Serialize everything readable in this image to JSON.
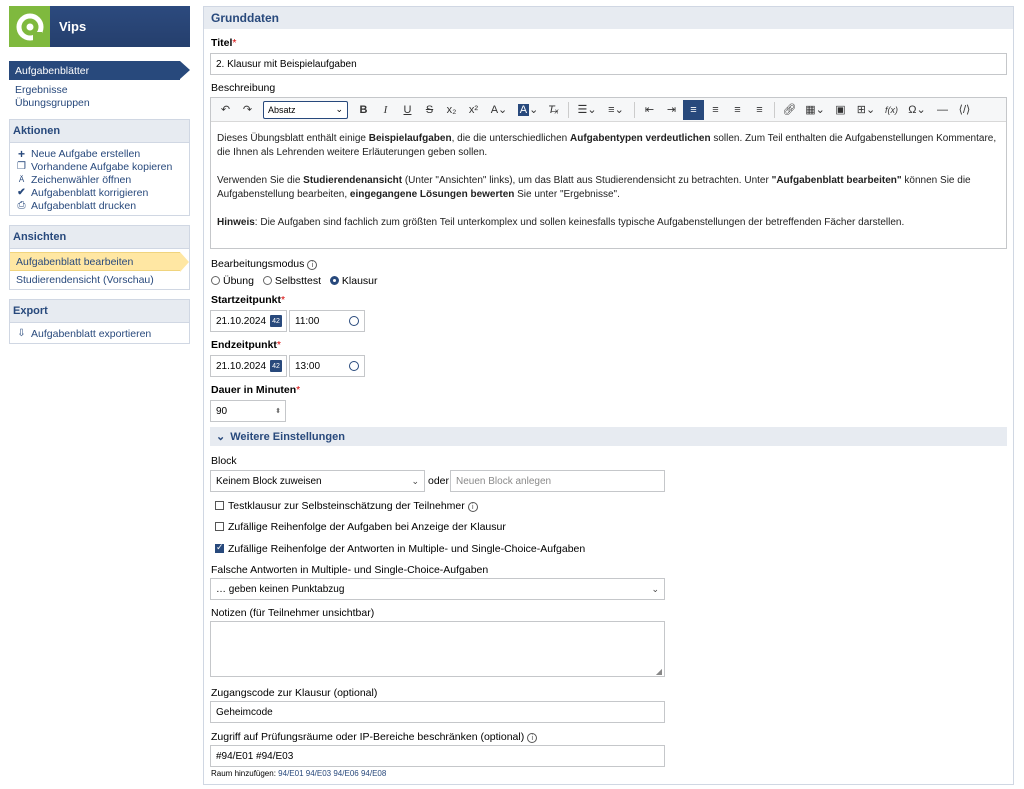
{
  "app": {
    "title": "Vips"
  },
  "nav": {
    "items": [
      "Aufgabenblätter",
      "Ergebnisse",
      "Übungsgruppen"
    ]
  },
  "actions": {
    "heading": "Aktionen",
    "items": [
      {
        "label": "Neue Aufgabe erstellen",
        "icon": "plus-icon"
      },
      {
        "label": "Vorhandene Aufgabe kopieren",
        "icon": "copy-icon"
      },
      {
        "label": "Zeichenwähler öffnen",
        "icon": "char-picker-icon"
      },
      {
        "label": "Aufgabenblatt korrigieren",
        "icon": "check-icon"
      },
      {
        "label": "Aufgabenblatt drucken",
        "icon": "print-icon"
      }
    ]
  },
  "views": {
    "heading": "Ansichten",
    "items": [
      "Aufgabenblatt bearbeiten",
      "Studierendensicht (Vorschau)"
    ]
  },
  "export": {
    "heading": "Export",
    "items": [
      {
        "label": "Aufgabenblatt exportieren",
        "icon": "export-icon"
      }
    ]
  },
  "main": {
    "section_title": "Grunddaten",
    "title_label": "Titel",
    "title_value": "2. Klausur mit Beispielaufgaben",
    "description_label": "Beschreibung",
    "toolbar": {
      "format_select": "Absatz"
    },
    "description": {
      "p1_a": "Dieses Übungsblatt enthält einige ",
      "p1_b": "Beispielaufgaben",
      "p1_c": ", die die unterschiedlichen ",
      "p1_d": "Aufgabentypen verdeutlichen",
      "p1_e": " sollen. Zum Teil enthalten die Aufgabenstellungen Kommentare, die Ihnen als Lehrenden weitere Erläuterungen geben sollen.",
      "p2_a": "Verwenden Sie die ",
      "p2_b": "Studierendenansicht",
      "p2_c": " (Unter \"Ansichten\" links), um das Blatt aus Studierendensicht zu betrachten. Unter ",
      "p2_d": "\"Aufgabenblatt bearbeiten\"",
      "p2_e": " können Sie die Aufgabenstellung bearbeiten, ",
      "p2_f": "eingegangene Lösungen bewerten",
      "p2_g": " Sie unter \"Ergebnisse\".",
      "p3_a": "Hinweis",
      "p3_b": ": Die Aufgaben sind fachlich zum größten Teil unterkomplex und sollen keinesfalls typische Aufgabenstellungen der betreffenden Fächer darstellen."
    },
    "mode_label": "Bearbeitungsmodus",
    "modes": [
      "Übung",
      "Selbsttest",
      "Klausur"
    ],
    "selected_mode": "Klausur",
    "start_label": "Startzeitpunkt",
    "start_date": "21.10.2024",
    "start_time": "11:00",
    "end_label": "Endzeitpunkt",
    "end_date": "21.10.2024",
    "end_time": "13:00",
    "duration_label": "Dauer in Minuten",
    "duration_value": "90",
    "more_settings": "Weitere Einstellungen",
    "block_label": "Block",
    "block_select": "Keinem Block zuweisen",
    "or_text": "oder",
    "new_block_placeholder": "Neuen Block anlegen",
    "options": [
      {
        "label": "Testklausur zur Selbsteinschätzung der Teilnehmer",
        "checked": false,
        "info": true
      },
      {
        "label": "Zufällige Reihenfolge der Aufgaben bei Anzeige der Klausur",
        "checked": false,
        "info": false
      },
      {
        "label": "Zufällige Reihenfolge der Antworten in Multiple- und Single-Choice-Aufgaben",
        "checked": true,
        "info": false
      }
    ],
    "wrong_answers_label": "Falsche Antworten in Multiple- und Single-Choice-Aufgaben",
    "wrong_answers_select": "… geben keinen Punktabzug",
    "notes_label": "Notizen (für Teilnehmer unsichtbar)",
    "access_code_label": "Zugangscode zur Klausur (optional)",
    "access_code_value": "Geheimcode",
    "ip_label": "Zugriff auf Prüfungsräume oder IP-Bereiche beschränken (optional)",
    "ip_value": "#94/E01 #94/E03",
    "room_add_prefix": "Raum hinzufügen:",
    "rooms": [
      "94/E01",
      "94/E03",
      "94/E06",
      "94/E08"
    ]
  },
  "colors": {
    "brand": "#28497c",
    "logo_green": "#7fb93e",
    "highlight": "#ffe7a3",
    "required": "#d60000"
  }
}
